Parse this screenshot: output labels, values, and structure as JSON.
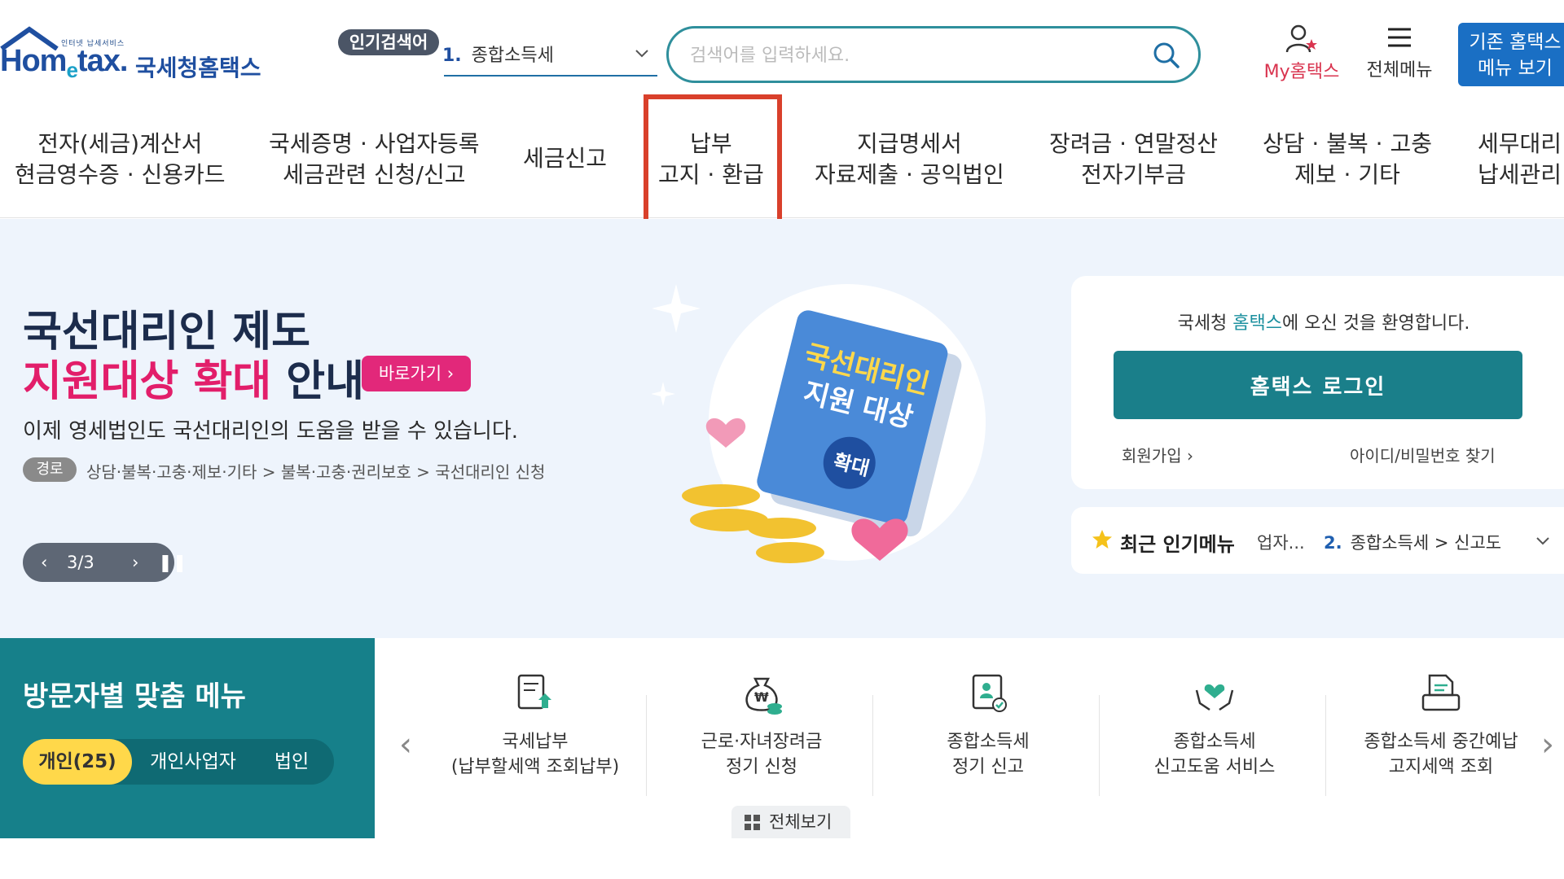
{
  "header": {
    "logo_small": "인터넷 납세서비스",
    "logo_main_pre": "Hom",
    "logo_main_e": "e",
    "logo_main_post": "tax.",
    "logo_kor": "국세청홈택스",
    "popular_badge": "인기검색어",
    "popular_rank_num": "1.",
    "popular_rank_text": "종합소득세",
    "search_placeholder": "검색어를 입력하세요.",
    "my_hometax": "My홈택스",
    "all_menu": "전체메뉴",
    "classic_line1": "기존 홈택스",
    "classic_line2": "메뉴 보기"
  },
  "nav": {
    "items": [
      {
        "line1": "전자(세금)계산서",
        "line2": "현금영수증 · 신용카드"
      },
      {
        "line1": "국세증명 · 사업자등록",
        "line2": "세금관련 신청/신고"
      },
      {
        "line1": "세금신고",
        "line2": ""
      },
      {
        "line1": "납부",
        "line2": "고지 · 환급"
      },
      {
        "line1": "지급명세서",
        "line2": "자료제출 · 공익법인"
      },
      {
        "line1": "장려금 · 연말정산",
        "line2": "전자기부금"
      },
      {
        "line1": "상담 · 불복 · 고충",
        "line2": "제보 · 기타"
      },
      {
        "line1": "세무대리",
        "line2": "납세관리"
      }
    ]
  },
  "banner": {
    "title1": "국선대리인 제도",
    "title2_pink": "지원대상 확대",
    "title2_rest": " 안내",
    "go_btn": "바로가기 ›",
    "subtitle": "이제 영세법인도 국선대리인의 도움을 받을 수 있습니다.",
    "path_badge": "경로",
    "path_text": "상담·불복·고충·제보·기타 > 불복·고충·권리보호 > 국선대리인 신청",
    "pager_count": "3/3",
    "art_book_line1": "국선대리인",
    "art_book_line2": "지원 대상",
    "art_badge": "확대"
  },
  "login": {
    "welcome_pre": "국세청 ",
    "welcome_accent": "홈택스",
    "welcome_post": "에 오신 것을 환영합니다.",
    "login_btn": "홈택스 로그인",
    "signup": "회원가입 ›",
    "find_id": "아이디/비밀번호 찾기"
  },
  "popular_menu": {
    "title": "최근 인기메뉴",
    "prev_item": "업자...",
    "cur_num": "2.",
    "cur_text": "종합소득세 > 신고도"
  },
  "visitor": {
    "title": "방문자별 맞춤 메뉴",
    "tabs": [
      "개인(25)",
      "개인사업자",
      "법인"
    ],
    "active_tab": 0
  },
  "quick_menu": {
    "items": [
      {
        "icon": "tax-payment-icon",
        "label": "국세납부\n(납부할세액 조회납부)"
      },
      {
        "icon": "money-bag-icon",
        "label": "근로·자녀장려금\n정기 신청"
      },
      {
        "icon": "income-tax-report-icon",
        "label": "종합소득세\n정기 신고"
      },
      {
        "icon": "heart-hands-icon",
        "label": "종합소득세\n신고도움 서비스"
      },
      {
        "icon": "notice-inquiry-icon",
        "label": "종합소득세 중간예납\n고지세액 조회"
      }
    ],
    "view_all": "전체보기"
  },
  "colors": {
    "brand_teal": "#16808a",
    "brand_blue": "#1f4fa0",
    "accent_pink": "#e21e6a",
    "highlight_red": "#d9402b",
    "tab_yellow": "#ffd84a"
  }
}
